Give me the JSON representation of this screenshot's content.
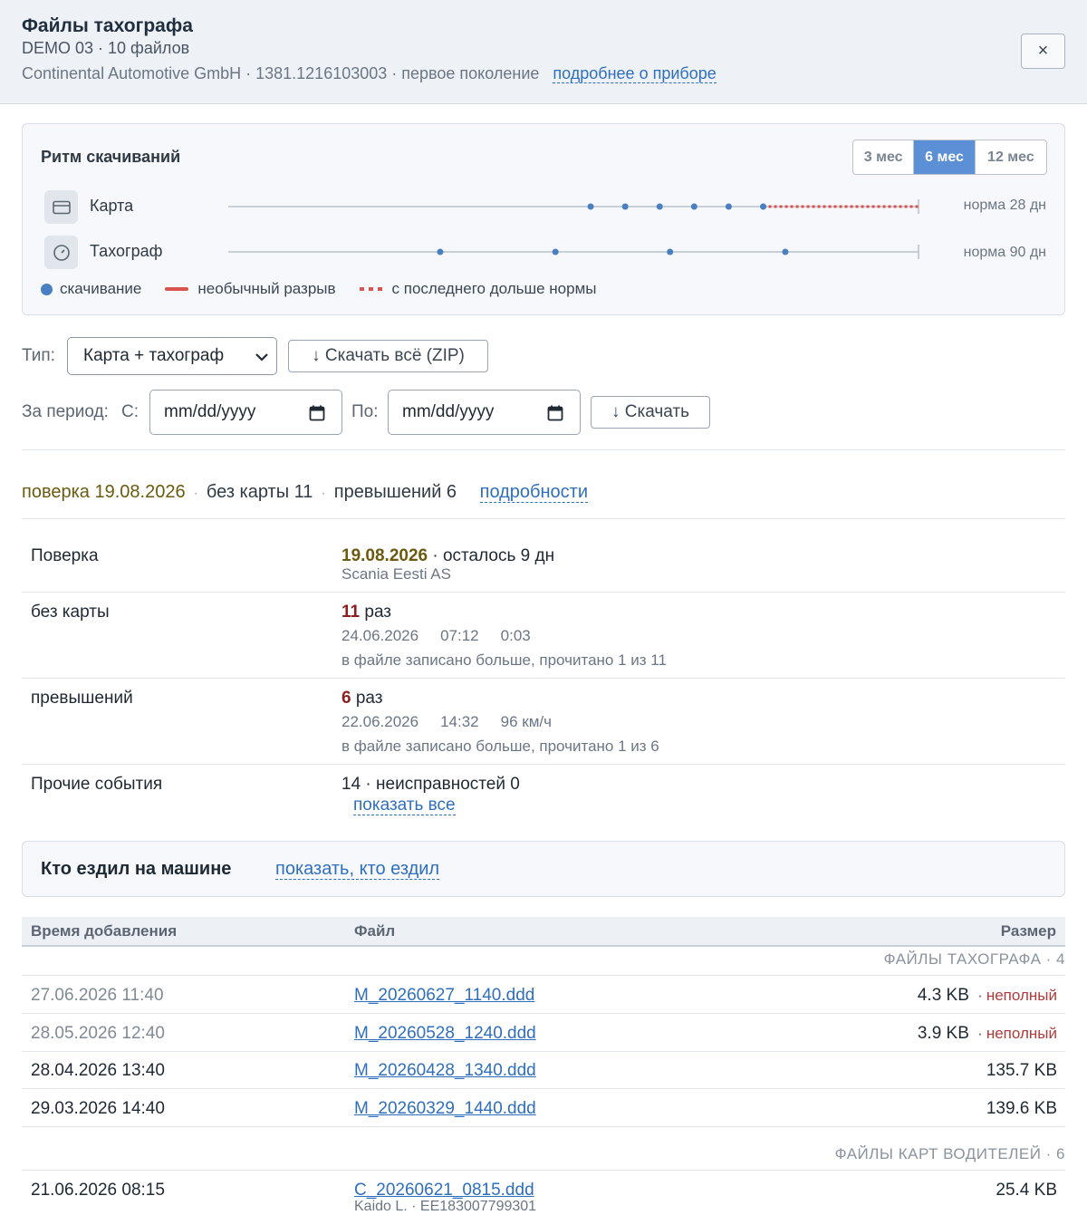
{
  "header": {
    "title": "Файлы тахографа",
    "subtitle": "DEMO 03 · 10 файлов",
    "meta": "Continental Automotive GmbH · 1381.1216103003 · первое поколение",
    "device_link": "подробнее о приборе",
    "close_label": "×"
  },
  "rhythm": {
    "title": "Ритм скачиваний",
    "periods": [
      "3 мес",
      "6 мес",
      "12 мес"
    ],
    "selected_period": "6 мес",
    "rows": [
      {
        "label": "Карта",
        "icon": "card-icon",
        "norm": "норма 28 дн",
        "downloads": [
          0.525,
          0.575,
          0.625,
          0.675,
          0.725,
          0.775
        ],
        "overdue_from": 0.775
      },
      {
        "label": "Тахограф",
        "icon": "clock-icon",
        "norm": "норма 90 дн",
        "downloads": [
          0.307,
          0.474,
          0.64,
          0.807
        ]
      }
    ],
    "legend": {
      "download": "скачивание",
      "gap": "необычный разрыв",
      "overdue": "с последнего дольше нормы"
    },
    "colors": {
      "dot": "#4a7fc1",
      "alert": "#d9534f",
      "accent": "#5b8fd6"
    }
  },
  "filters": {
    "type_label": "Тип:",
    "type_value": "Карта + тахограф",
    "download_all": "↓ Скачать всё (ZIP)",
    "period_label": "За период:",
    "from_label": "С:",
    "from_placeholder": "mm/dd/yyyy",
    "to_label": "По:",
    "to_placeholder": "mm/dd/yyyy",
    "download": "↓ Скачать"
  },
  "summary": {
    "calibration": "поверка 19.08.2026",
    "no_card": "без карты 11",
    "overspeed": "превышений 6",
    "details_link": "подробности"
  },
  "details": {
    "calibration": {
      "label": "Поверка",
      "date": "19.08.2026",
      "rest": "· осталось 9 дн",
      "company": "Scania Eesti AS"
    },
    "no_card": {
      "label": "без карты",
      "count": "11",
      "unit": "раз",
      "date": "24.06.2026",
      "time": "07:12",
      "duration": "0:03",
      "note": "в файле записано больше, прочитано 1 из 11"
    },
    "overspeed": {
      "label": "превышений",
      "count": "6",
      "unit": "раз",
      "date": "22.06.2026",
      "time": "14:32",
      "speed": "96 км/ч",
      "note": "в файле записано больше, прочитано 1 из 6"
    },
    "other": {
      "label": "Прочие события",
      "value": "14 · неисправностей 0",
      "link": "показать все"
    }
  },
  "drivers": {
    "title": "Кто ездил на машине",
    "link": "показать, кто ездил"
  },
  "table": {
    "headers": [
      "Время добавления",
      "Файл",
      "Размер"
    ],
    "groups": [
      {
        "title": "ФАЙЛЫ ТАХОГРАФА · 4",
        "rows": [
          {
            "time": "27.06.2026 11:40",
            "file": "M_20260627_1140.ddd",
            "size": "4.3 KB",
            "flag": "неполный",
            "muted": true
          },
          {
            "time": "28.05.2026 12:40",
            "file": "M_20260528_1240.ddd",
            "size": "3.9 KB",
            "flag": "неполный",
            "muted": true
          },
          {
            "time": "28.04.2026 13:40",
            "file": "M_20260428_1340.ddd",
            "size": "135.7 KB",
            "flag": "",
            "muted": false
          },
          {
            "time": "29.03.2026 14:40",
            "file": "M_20260329_1440.ddd",
            "size": "139.6 KB",
            "flag": "",
            "muted": false
          }
        ]
      },
      {
        "title": "ФАЙЛЫ КАРТ ВОДИТЕЛЕЙ · 6",
        "rows": [
          {
            "time": "21.06.2026 08:15",
            "file": "C_20260621_0815.ddd",
            "size": "25.4 KB",
            "flag": "",
            "muted": false,
            "sub": "Kaido L. · EE183007799301"
          }
        ]
      }
    ]
  }
}
